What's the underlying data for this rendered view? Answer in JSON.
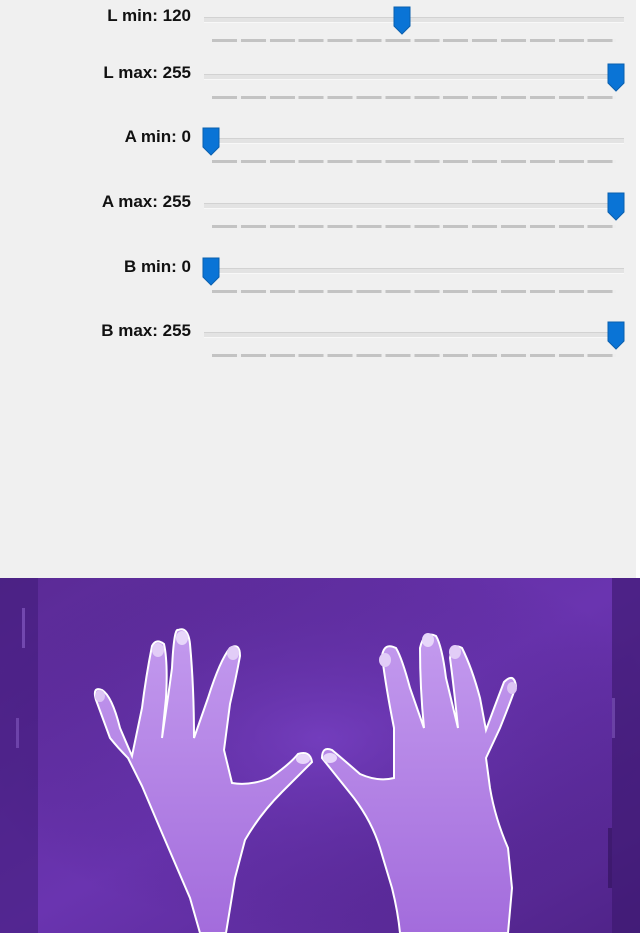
{
  "sliders": [
    {
      "label": "L min: 120",
      "value": 120,
      "max": 255
    },
    {
      "label": "L max: 255",
      "value": 255,
      "max": 255
    },
    {
      "label": "A min: 0",
      "value": 0,
      "max": 255
    },
    {
      "label": "A max: 255",
      "value": 255,
      "max": 255
    },
    {
      "label": "B min: 0",
      "value": 0,
      "max": 255
    },
    {
      "label": "B max: 255",
      "value": 255,
      "max": 255
    }
  ],
  "colors": {
    "thumb": "#0a74d6",
    "panel_bg": "#f0f0f0",
    "image_bg": "#5d2e9e",
    "hands": "#b888e6"
  },
  "image": {
    "subject": "two-hands-segmentation-preview"
  }
}
